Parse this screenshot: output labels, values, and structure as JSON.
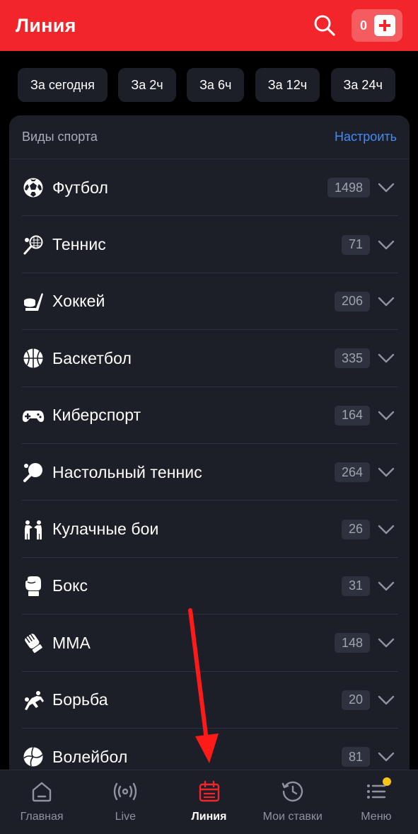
{
  "header": {
    "title": "Линия",
    "balance": "0"
  },
  "filters": [
    "За сегодня",
    "За 2ч",
    "За 6ч",
    "За 12ч",
    "За 24ч"
  ],
  "panel": {
    "title": "Виды спорта",
    "setup_label": "Настроить",
    "sports": [
      {
        "name": "Футбол",
        "count": "1498",
        "icon": "football-icon"
      },
      {
        "name": "Теннис",
        "count": "71",
        "icon": "tennis-icon"
      },
      {
        "name": "Хоккей",
        "count": "206",
        "icon": "hockey-icon"
      },
      {
        "name": "Баскетбол",
        "count": "335",
        "icon": "basketball-icon"
      },
      {
        "name": "Киберспорт",
        "count": "164",
        "icon": "gamepad-icon"
      },
      {
        "name": "Настольный теннис",
        "count": "264",
        "icon": "table-tennis-icon"
      },
      {
        "name": "Кулачные бои",
        "count": "26",
        "icon": "fist-fight-icon"
      },
      {
        "name": "Бокс",
        "count": "31",
        "icon": "boxing-glove-icon"
      },
      {
        "name": "MMA",
        "count": "148",
        "icon": "mma-glove-icon"
      },
      {
        "name": "Борьба",
        "count": "20",
        "icon": "wrestling-icon"
      },
      {
        "name": "Волейбол",
        "count": "81",
        "icon": "volleyball-icon"
      }
    ]
  },
  "nav": [
    {
      "label": "Главная",
      "icon": "home-icon"
    },
    {
      "label": "Live",
      "icon": "live-broadcast-icon"
    },
    {
      "label": "Линия",
      "icon": "calendar-icon",
      "active": true
    },
    {
      "label": "Мои ставки",
      "icon": "history-clock-icon"
    },
    {
      "label": "Меню",
      "icon": "menu-list-icon"
    }
  ],
  "colors": {
    "brand": "#f2262a",
    "accent_link": "#3d8bff",
    "panel": "#1c1f28",
    "badge": "#f5c518"
  }
}
